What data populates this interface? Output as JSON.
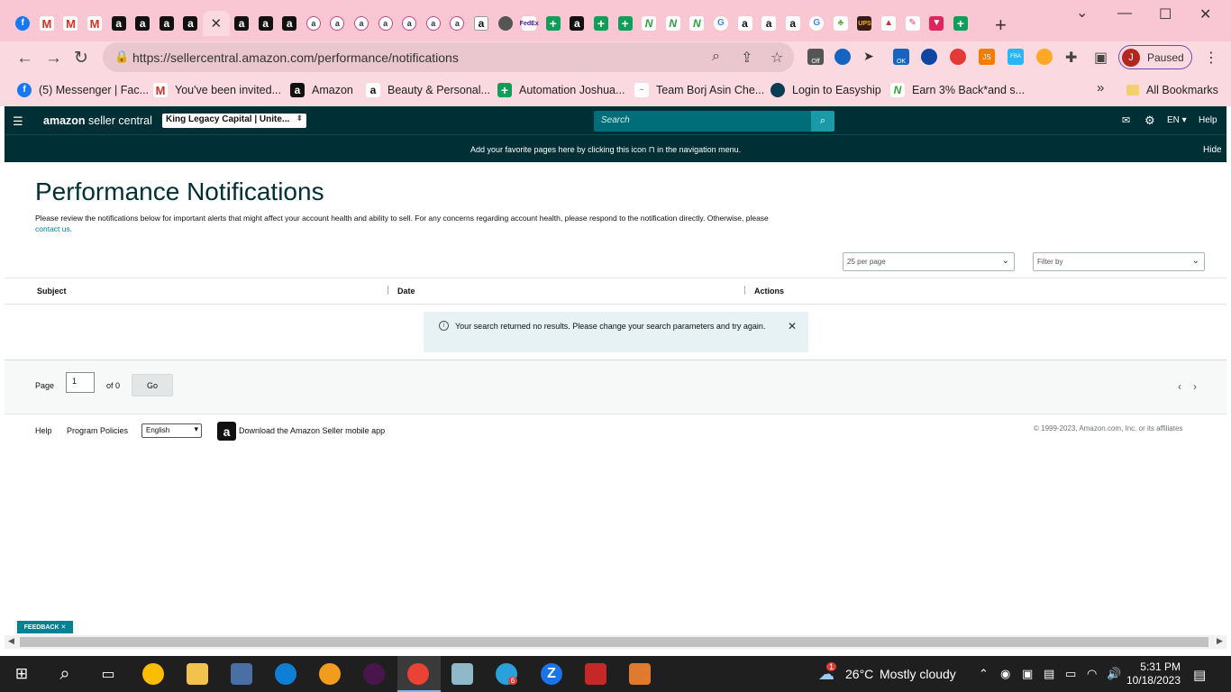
{
  "browser": {
    "url": "https://sellercentral.amazon.com/performance/notifications",
    "profile_initial": "J",
    "profile_status": "Paused",
    "extension_badge_off": "Off",
    "extension_badge_ok": "OK",
    "extension_badge_js": "JS",
    "extension_badge_fba": "FBA",
    "bookmarks": [
      {
        "label": "(5) Messenger | Fac...",
        "icon": "facebook-icon"
      },
      {
        "label": "You've been invited...",
        "icon": "gmail-icon"
      },
      {
        "label": "Amazon",
        "icon": "amazon-icon"
      },
      {
        "label": "Beauty & Personal...",
        "icon": "amazon-icon"
      },
      {
        "label": "Automation Joshua...",
        "icon": "sheets-icon"
      },
      {
        "label": "Team Borj Asin Che...",
        "icon": "signature-icon"
      },
      {
        "label": "Login to Easyship",
        "icon": "easyship-icon"
      },
      {
        "label": "Earn 3% Back*and s...",
        "icon": "rakuten-icon"
      }
    ],
    "bookmarks_more": "»",
    "all_bookmarks": "All Bookmarks"
  },
  "header": {
    "logo_brand": "amazon",
    "logo_text": "seller central",
    "account_selector": "King Legacy Capital | Unite...",
    "search_placeholder": "Search",
    "language": "EN",
    "help": "Help"
  },
  "favorites_bar": {
    "message": "Add your favorite pages here by clicking this icon ⊓ in the navigation menu.",
    "hide": "Hide"
  },
  "main": {
    "title": "Performance Notifications",
    "description": "Please review the notifications below for important alerts that might affect your account health and ability to sell. For any concerns regarding account health, please respond to the notification directly. Otherwise, please",
    "contact_link": "contact us.",
    "per_page": "25 per page",
    "filter_placeholder": "Filter by",
    "columns": [
      "Subject",
      "Date",
      "Actions"
    ],
    "empty_message": "Your search returned no results. Please change your search parameters and try again."
  },
  "pagination": {
    "page_label": "Page",
    "page_value": "1",
    "of_label": "of 0",
    "go": "Go"
  },
  "footer": {
    "help": "Help",
    "program_policies": "Program Policies",
    "language": "English",
    "download_app": "Download the Amazon Seller mobile app",
    "copyright": "© 1999-2023, Amazon.com, Inc. or its affiliates"
  },
  "feedback": "FEEDBACK ✕",
  "taskbar": {
    "weather_temp": "26°C",
    "weather_desc": "Mostly cloudy",
    "weather_badge": "1",
    "telegram_badge": "6",
    "time": "5:31 PM",
    "date": "10/18/2023"
  },
  "colors": {
    "chrome_pink": "#f9c7d3",
    "seller_header": "#002f36",
    "accent_teal": "#008296",
    "alert_bg": "#e6f2f3"
  }
}
